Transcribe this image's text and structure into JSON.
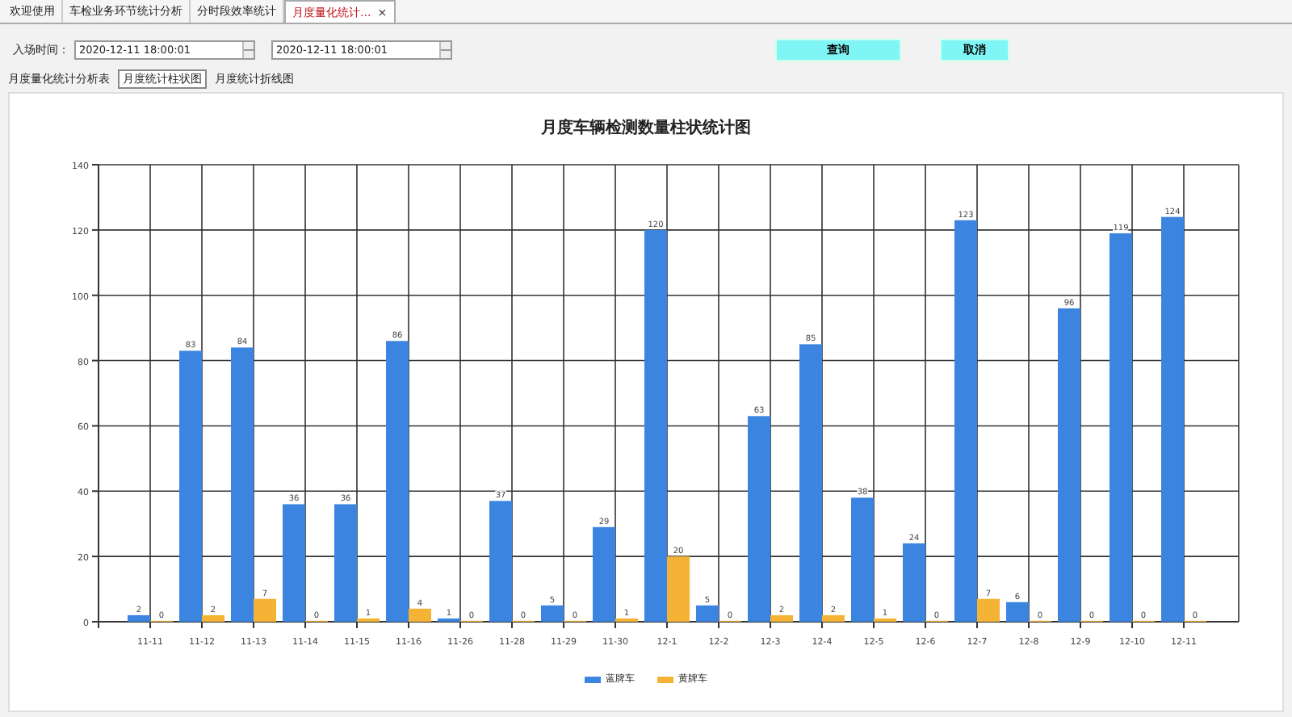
{
  "tabs": [
    {
      "label": "欢迎使用",
      "selected": false
    },
    {
      "label": "车检业务环节统计分析",
      "selected": false
    },
    {
      "label": "分时段效率统计",
      "selected": false
    },
    {
      "label": "月度量化统计...",
      "selected": true,
      "close": "×"
    }
  ],
  "filter": {
    "label": "入场时间：",
    "start": "2020-12-11 18:00:01",
    "end": "2020-12-11 18:00:01"
  },
  "buttons": [
    "查询",
    "取消"
  ],
  "subtabs": [
    {
      "label": "月度量化统计分析表",
      "selected": false
    },
    {
      "label": "月度统计柱状图",
      "selected": true
    },
    {
      "label": "月度统计折线图",
      "selected": false
    }
  ],
  "chart": {
    "chart_data": {
      "type": "bar",
      "title": "月度车辆检测数量柱状统计图",
      "categories": [
        "11-11",
        "11-12",
        "11-13",
        "11-14",
        "11-15",
        "11-16",
        "11-26",
        "11-28",
        "11-29",
        "11-30",
        "12-1",
        "12-2",
        "12-3",
        "12-4",
        "12-5",
        "12-6",
        "12-7",
        "12-8",
        "12-9",
        "12-10",
        "12-11"
      ],
      "series": [
        {
          "name": "蓝牌车",
          "color": "#3b84e0",
          "values": [
            2,
            83,
            84,
            36,
            36,
            86,
            1,
            37,
            5,
            29,
            120,
            5,
            63,
            85,
            38,
            24,
            123,
            6,
            96,
            119,
            124
          ]
        },
        {
          "name": "黄牌车",
          "color": "#f5b335",
          "values": [
            0,
            2,
            7,
            0,
            1,
            4,
            0,
            0,
            0,
            1,
            20,
            0,
            2,
            2,
            1,
            0,
            7,
            0,
            0,
            0,
            0
          ]
        }
      ],
      "ylim": [
        0,
        140
      ],
      "yticks": [
        0,
        20,
        40,
        60,
        80,
        100,
        120,
        140
      ],
      "grid": true,
      "data_labels": true
    }
  }
}
